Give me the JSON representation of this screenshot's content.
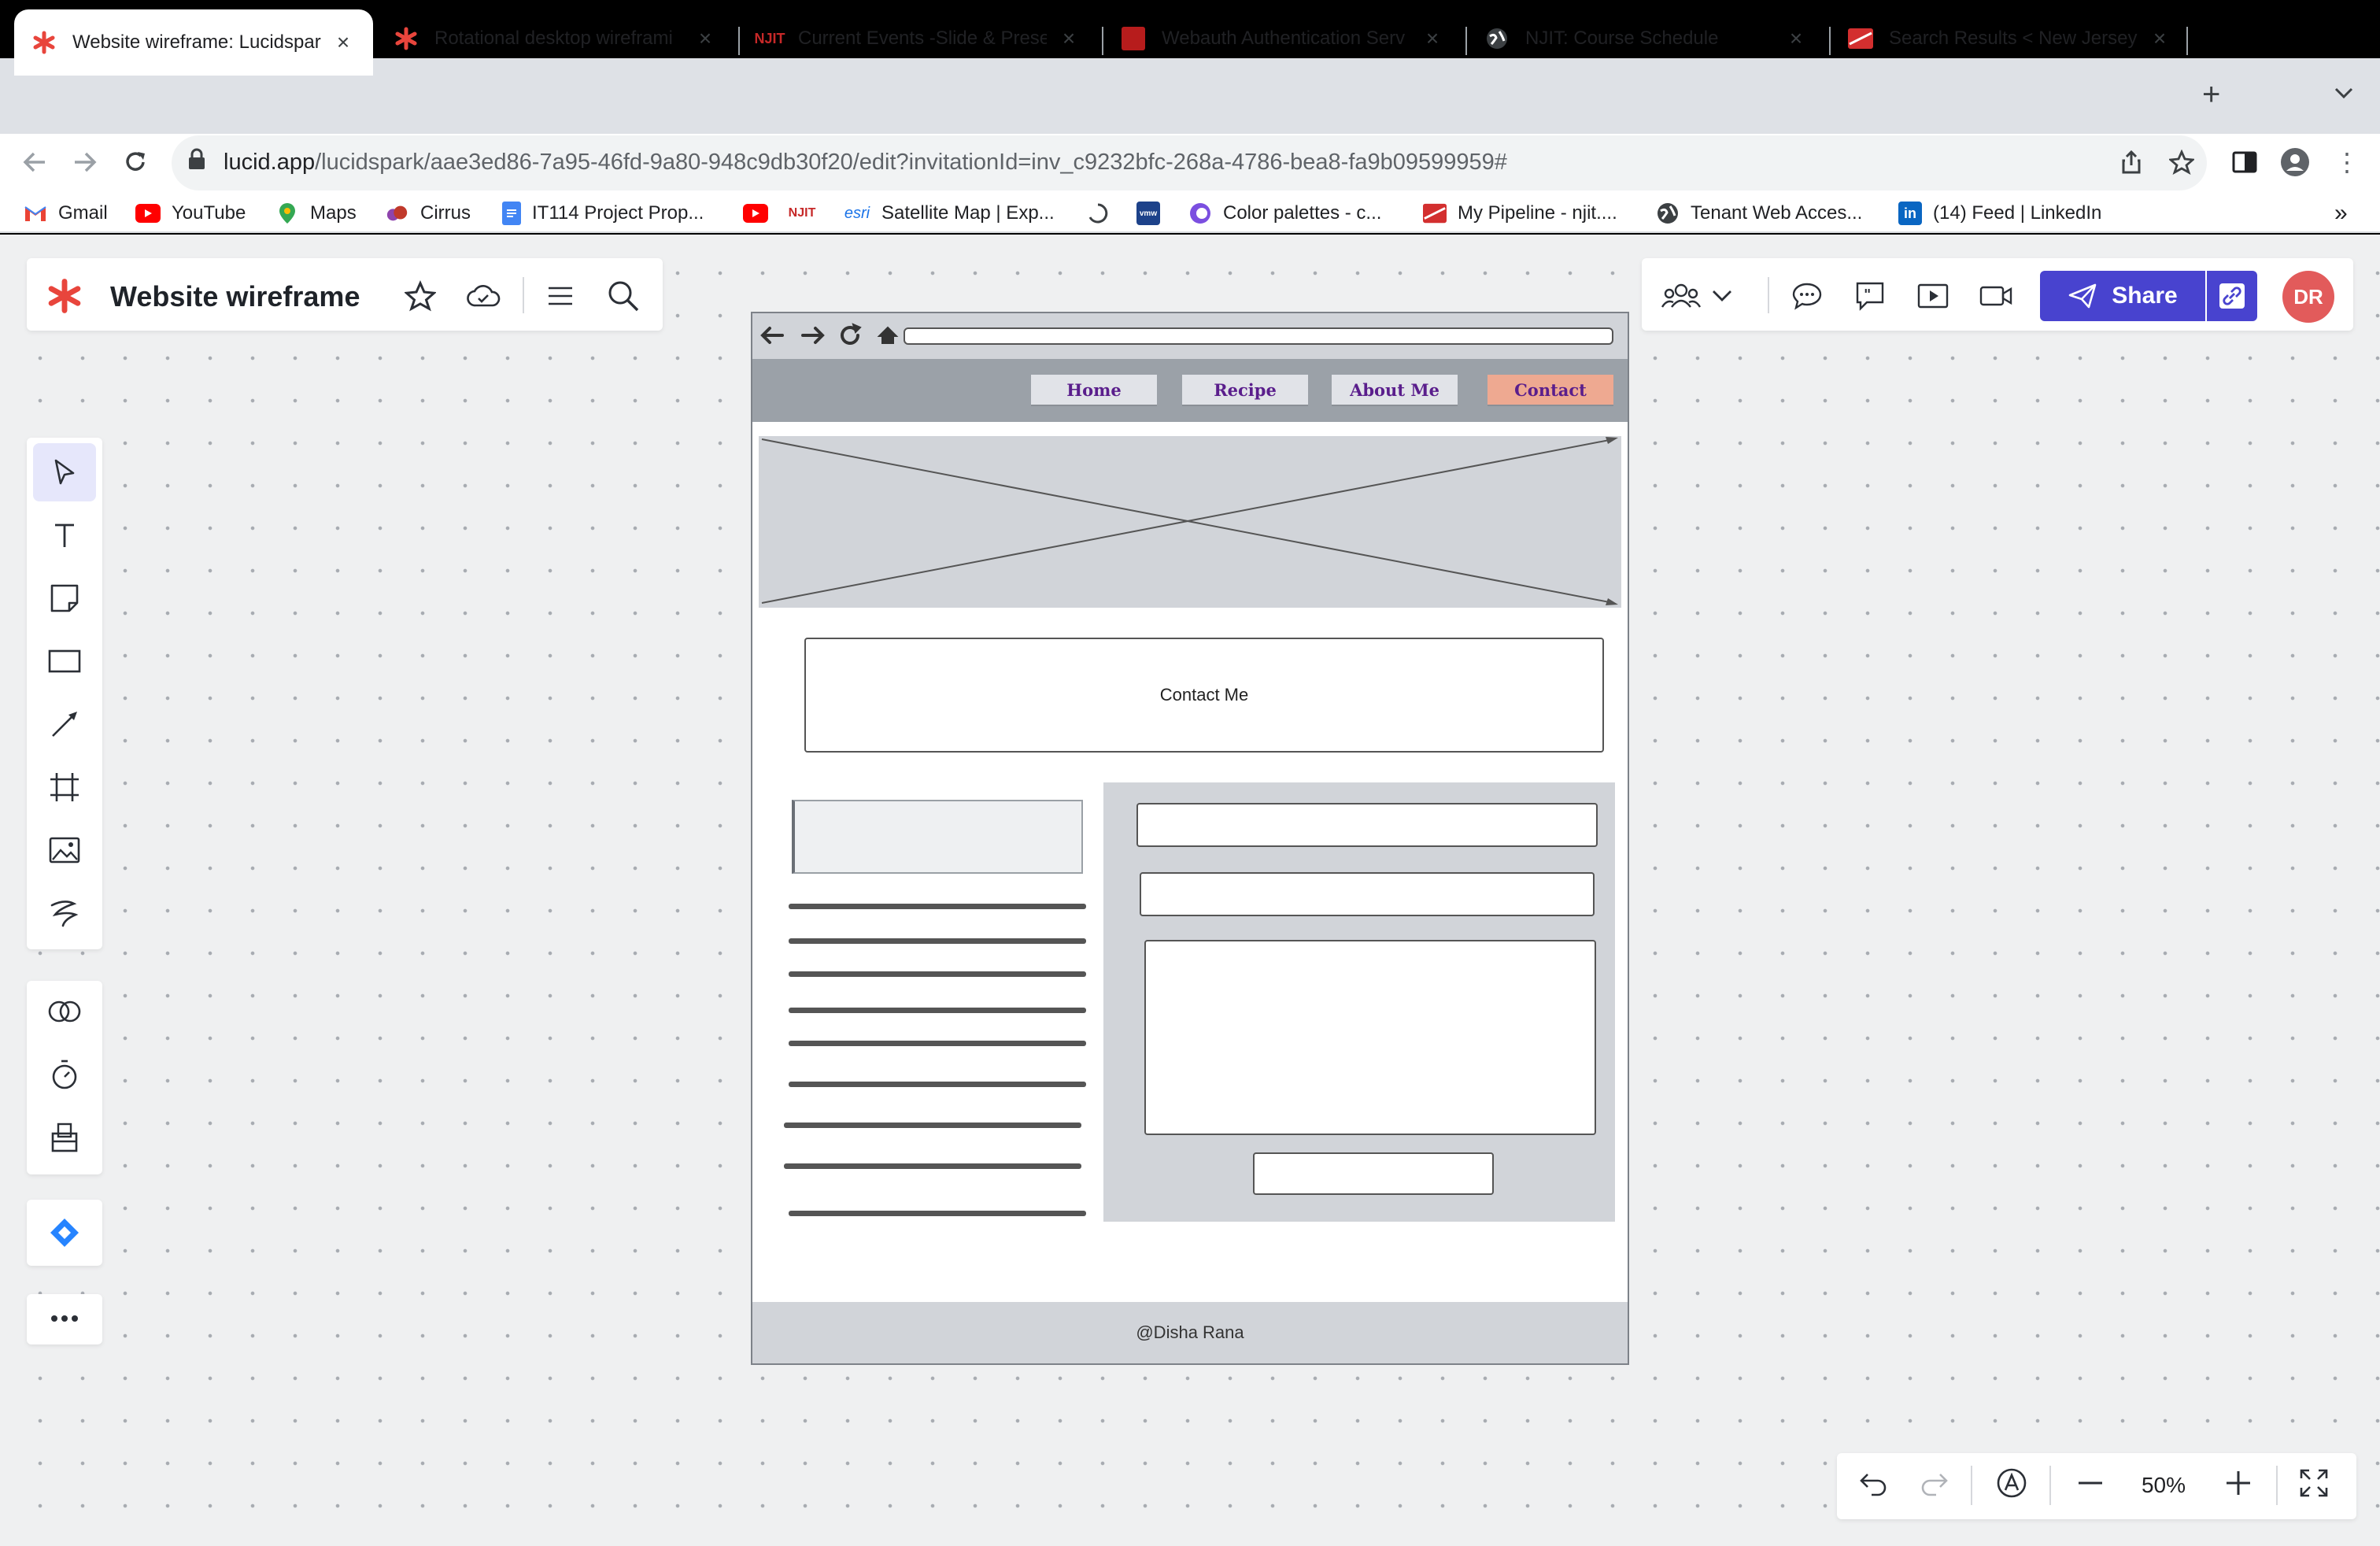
{
  "browser": {
    "tabs": [
      {
        "label": "Website wireframe: Lucidspar",
        "active": true
      },
      {
        "label": "Rotational desktop wireframi"
      },
      {
        "label": "Current Events -Slide & Prese"
      },
      {
        "label": "Webauth Authentication Serv"
      },
      {
        "label": "NJIT: Course Schedule"
      },
      {
        "label": "Search Results < New Jersey"
      }
    ],
    "url_host": "lucid.app",
    "url_path": "/lucidspark/aae3ed86-7a95-46fd-9a80-948c9db30f20/edit?invitationId=inv_c9232bfc-268a-4786-bea8-fa9b09599959#",
    "bookmarks": [
      "Gmail",
      "YouTube",
      "Maps",
      "Cirrus",
      "IT114 Project Prop...",
      "Satellite Map | Exp...",
      "Color palettes - c...",
      "My Pipeline - njit....",
      "Tenant Web Acces...",
      "(14) Feed | LinkedIn"
    ],
    "bookmarks_overflow": "»",
    "esri_label": "esri"
  },
  "app": {
    "doc_title": "Website wireframe",
    "share_label": "Share",
    "avatar_initials": "DR",
    "zoom": "50%",
    "accent_color": "#4843cf"
  },
  "wireframe": {
    "nav": [
      "Home",
      "Recipe",
      "About Me",
      "Contact"
    ],
    "contact_heading": "Contact Me",
    "footer": "@Disha Rana"
  }
}
